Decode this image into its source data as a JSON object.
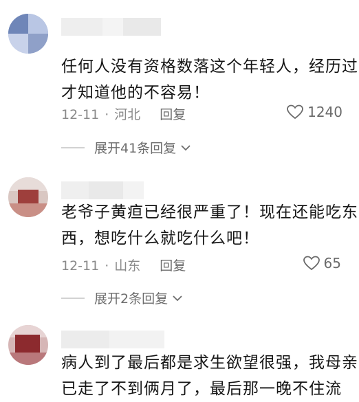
{
  "comments": [
    {
      "text_lines": [
        "任何人没有资格数落这个年轻人，经历过",
        "才知道他的不容易！"
      ],
      "date": "12-11",
      "location": "河北",
      "reply_label": "回复",
      "likes": "1240",
      "expand_label": "展开41条回复"
    },
    {
      "text_lines": [
        "老爷子黄疸已经很严重了！现在还能吃东",
        "西，想吃什么就吃什么吧！"
      ],
      "date": "12-11",
      "location": "山东",
      "reply_label": "回复",
      "likes": "65",
      "expand_label": "展开2条回复"
    },
    {
      "text_lines": [
        "病人到了最后都是求生欲望很强，我母亲",
        "已走了不到俩月了，最后那一晚不住流"
      ]
    }
  ],
  "icons": {
    "like": "heart-icon",
    "expand": "chevron-down-icon"
  }
}
